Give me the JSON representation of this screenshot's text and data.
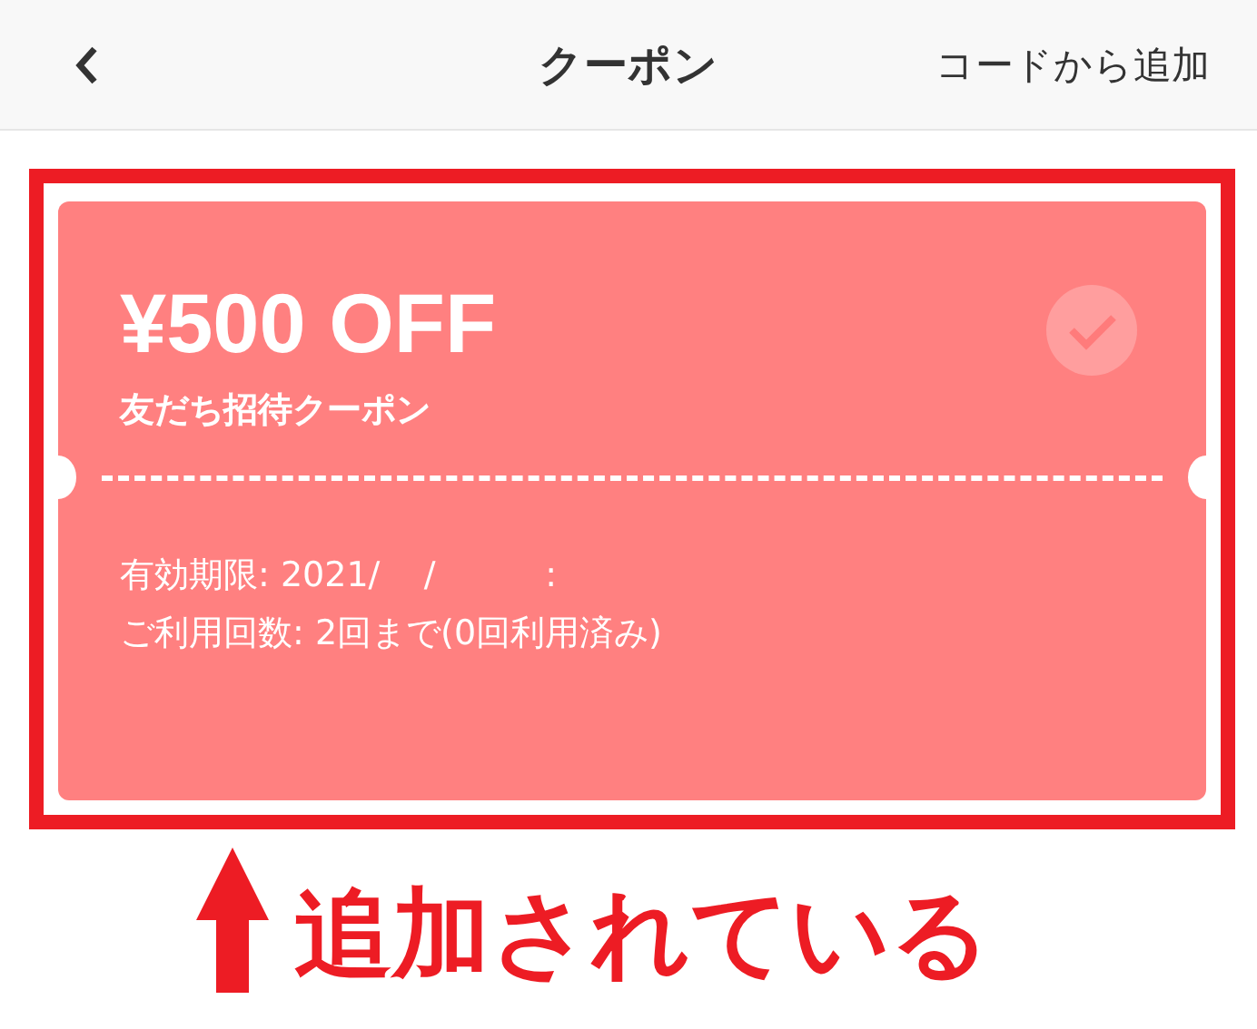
{
  "header": {
    "title": "クーポン",
    "action": "コードから追加"
  },
  "coupon": {
    "amount": "¥500 OFF",
    "name": "友だち招待クーポン",
    "checked": true,
    "expiry": "有効期限: 2021/    /          :",
    "usage": "ご利用回数: 2回まで(0回利用済み)"
  },
  "annotation": {
    "text": "追加されている"
  }
}
